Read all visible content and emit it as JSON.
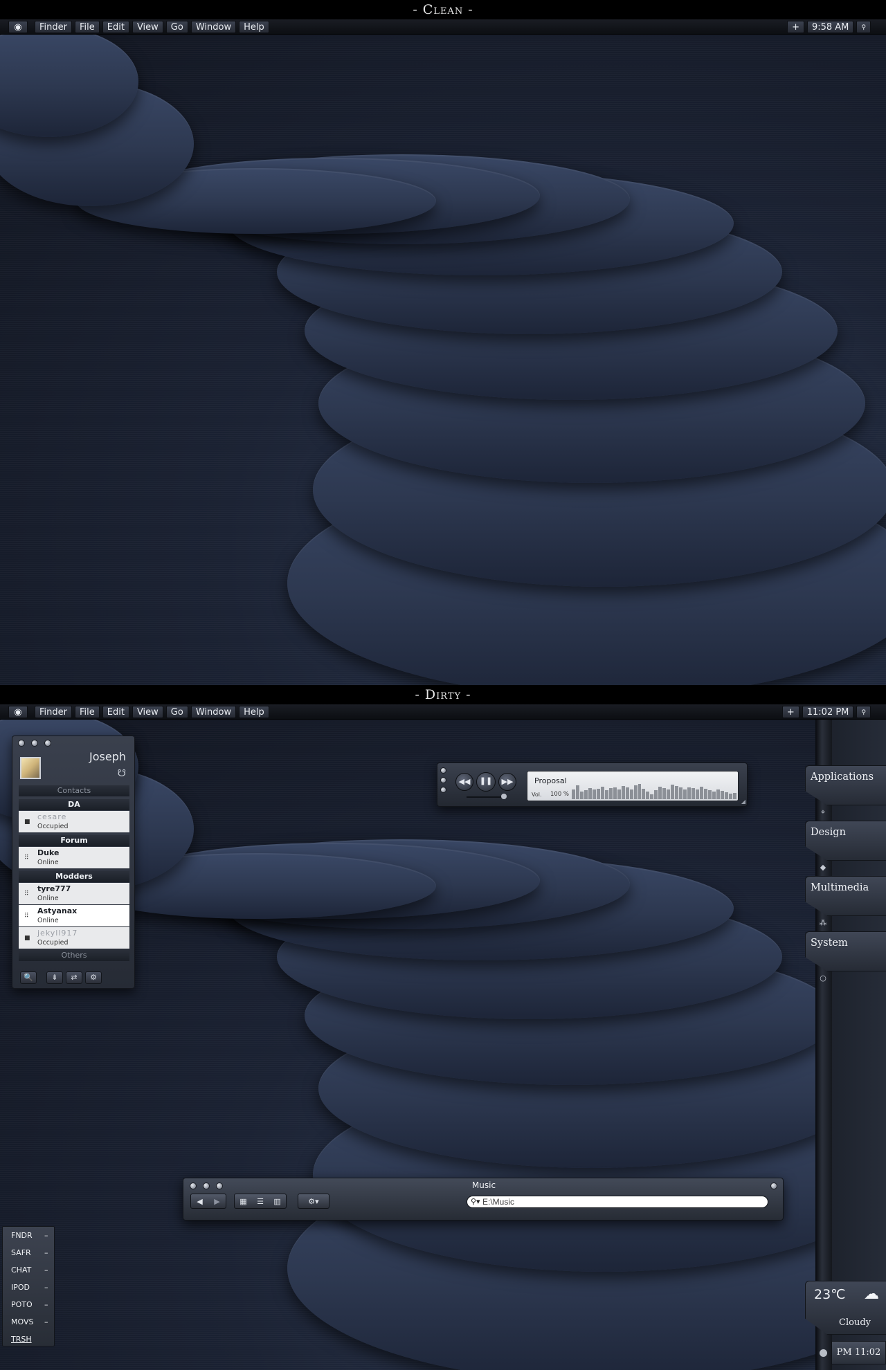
{
  "titles": {
    "clean": "- Clean -",
    "dirty": "- Dirty -"
  },
  "menubar": {
    "apple": "",
    "items": [
      "Finder",
      "File",
      "Edit",
      "View",
      "Go",
      "Window",
      "Help"
    ],
    "plus": "+",
    "search_icon": "🔍",
    "clean_time": "9:58 AM",
    "dirty_time": "11:02 PM"
  },
  "chat": {
    "user": "Joseph",
    "status_icon": "☋",
    "contacts_header": "Contacts",
    "groups": [
      {
        "name": "DA",
        "contacts": [
          {
            "name": "cesare",
            "status": "Occupied"
          }
        ]
      },
      {
        "name": "Forum",
        "contacts": [
          {
            "name": "Duke",
            "status": "Online"
          }
        ]
      },
      {
        "name": "Modders",
        "contacts": [
          {
            "name": "tyre777",
            "status": "Online"
          },
          {
            "name": "Astyanax",
            "status": "Online"
          },
          {
            "name": "jekyll917",
            "status": "Occupied"
          }
        ]
      }
    ],
    "others_header": "Others",
    "tools": [
      "🔍",
      "⇟",
      "⇄",
      "⚙"
    ]
  },
  "player": {
    "song": "Proposal",
    "vol_label": "Vol.",
    "vol_value": "100 %",
    "buttons": {
      "rewind": "◀◀",
      "pause": "❚❚",
      "forward": "▶▶"
    },
    "volume_level": 1.0
  },
  "dock": {
    "tabs": [
      "Applications",
      "Design",
      "Multimedia",
      "System"
    ],
    "icons": [
      "⌖",
      "◆",
      "⁂",
      "○"
    ]
  },
  "weather": {
    "temp": "23℃",
    "condition": "Cloudy",
    "icon": "☁"
  },
  "clock": {
    "time": "PM 11:02"
  },
  "shortcuts": [
    {
      "label": "FNDR",
      "dash": "–"
    },
    {
      "label": "SAFR",
      "dash": "–"
    },
    {
      "label": "CHAT",
      "dash": "–"
    },
    {
      "label": "IPOD",
      "dash": "–"
    },
    {
      "label": "POTO",
      "dash": "–"
    },
    {
      "label": "MOVS",
      "dash": "–"
    },
    {
      "label": "TRSH",
      "dash": ""
    }
  ],
  "finder": {
    "title": "Music",
    "nav": [
      "◀",
      "▶"
    ],
    "views": [
      "▦",
      "☰",
      "▥"
    ],
    "action": "⚙▾",
    "search_icon": "🔍",
    "search_value": "E:\\Music"
  }
}
